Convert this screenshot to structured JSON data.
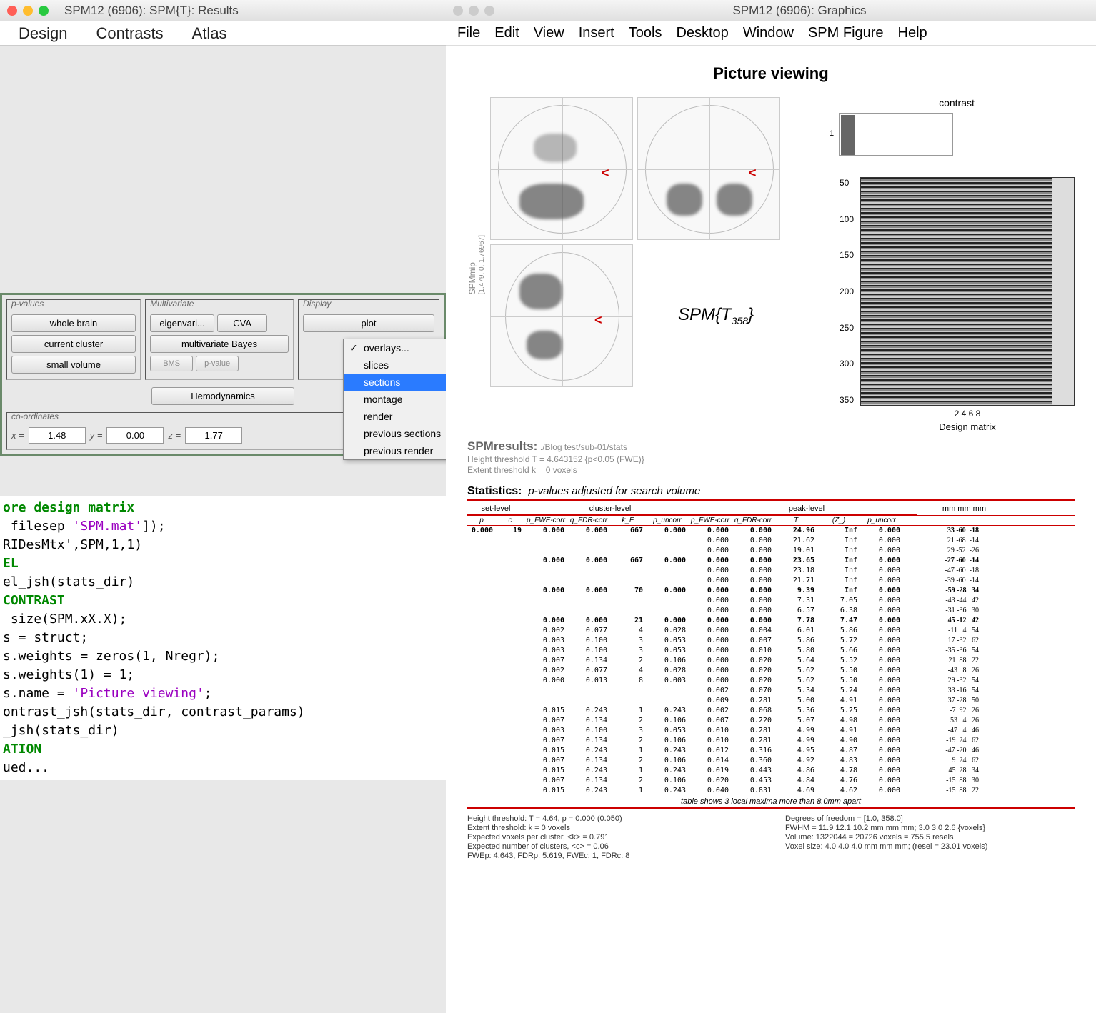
{
  "results_window": {
    "title": "SPM12 (6906): SPM{T}: Results",
    "menu": [
      "Design",
      "Contrasts",
      "Atlas"
    ],
    "groups": {
      "pvalues": {
        "label": "p-values",
        "buttons": [
          "whole brain",
          "current cluster",
          "small volume"
        ]
      },
      "multivariate": {
        "label": "Multivariate",
        "buttons": [
          "eigenvari...",
          "CVA",
          "multivariate Bayes",
          "BMS",
          "p-value"
        ]
      },
      "display": {
        "label": "Display",
        "buttons": [
          "plot"
        ]
      },
      "hemodynamics": "Hemodynamics",
      "coords": {
        "label": "co-ordinates",
        "x_label": "x =",
        "x": "1.48",
        "y_label": "y =",
        "y": "0.00",
        "z_label": "z =",
        "z": "1.77"
      }
    },
    "popup": [
      "overlays...",
      "slices",
      "sections",
      "montage",
      "render",
      "previous sections",
      "previous render"
    ]
  },
  "code_lines": [
    {
      "cls": "cmt",
      "t": "ore design matrix"
    },
    {
      "cls": "",
      "t": " filesep 'SPM.mat']);"
    },
    {
      "cls": "",
      "t": "RIDesMtx',SPM,1,1)"
    },
    {
      "cls": "",
      "t": ""
    },
    {
      "cls": "cmt",
      "t": "EL"
    },
    {
      "cls": "",
      "t": "el_jsh(stats_dir)"
    },
    {
      "cls": "",
      "t": ""
    },
    {
      "cls": "cmt",
      "t": "CONTRAST"
    },
    {
      "cls": "",
      "t": " size(SPM.xX.X);"
    },
    {
      "cls": "",
      "t": "s = struct;"
    },
    {
      "cls": "",
      "t": "s.weights = zeros(1, Nregr);"
    },
    {
      "cls": "",
      "t": "s.weights(1) = 1;"
    },
    {
      "cls": "",
      "t": "s.name = 'Picture viewing';"
    },
    {
      "cls": "",
      "t": "ontrast_jsh(stats_dir, contrast_params)"
    },
    {
      "cls": "",
      "t": ""
    },
    {
      "cls": "",
      "t": ""
    },
    {
      "cls": "",
      "t": "_jsh(stats_dir)"
    },
    {
      "cls": "",
      "t": ""
    },
    {
      "cls": "cmt",
      "t": "ATION"
    },
    {
      "cls": "",
      "t": "ued..."
    }
  ],
  "graphics_window": {
    "title": "SPM12 (6906): Graphics",
    "menu": [
      "File",
      "Edit",
      "View",
      "Insert",
      "Tools",
      "Desktop",
      "Window",
      "SPM Figure",
      "Help"
    ],
    "fig_title": "Picture viewing",
    "mip_label": "SPMmip",
    "mip_coords": "[1.479, 0, 1.76967]",
    "spmt": "SPM{T",
    "spmt_sub": "358",
    "spmt_end": "}",
    "contrast_label": "contrast",
    "design_matrix": {
      "yticks": [
        "50",
        "100",
        "150",
        "200",
        "250",
        "300",
        "350"
      ],
      "xticks": "2    4    6    8",
      "caption": "Design matrix"
    },
    "spmresults": {
      "title": "SPMresults:",
      "path": "./Blog test/sub-01/stats",
      "line1": "Height threshold T = 4.643152  {p<0.05 (FWE)}",
      "line2": "Extent threshold k = 0 voxels"
    },
    "stats_title": "Statistics:",
    "stats_sub": "p-values adjusted for search volume",
    "hdr_groups": {
      "set": "set-level",
      "cluster": "cluster-level",
      "peak": "peak-level",
      "mm": "mm mm mm"
    },
    "subhdr": [
      "p",
      "c",
      "p_FWE-corr",
      "q_FDR-corr",
      "k_E",
      "p_uncorr",
      "p_FWE-corr",
      "q_FDR-corr",
      "T",
      "(Z_)",
      "p_uncorr"
    ],
    "localmax": "table shows 3 local maxima more than 8.0mm apart",
    "footer_left": [
      "Height threshold: T = 4.64, p = 0.000 (0.050)",
      "Extent threshold: k = 0 voxels",
      "Expected voxels per cluster, <k> = 0.791",
      "Expected number of clusters, <c> = 0.06",
      "FWEp: 4.643, FDRp: 5.619, FWEc: 1, FDRc: 8"
    ],
    "footer_right": [
      "Degrees of freedom = [1.0, 358.0]",
      "FWHM = 11.9 12.1 10.2 mm mm mm; 3.0 3.0 2.6 {voxels}",
      "Volume: 1322044 = 20726 voxels = 755.5 resels",
      "Voxel size: 4.0 4.0 4.0 mm mm mm; (resel = 23.01 voxels)"
    ]
  },
  "chart_data": {
    "type": "table",
    "title": "Statistics: p-values adjusted for search volume",
    "columns": [
      "set_p",
      "set_c",
      "cl_pFWE",
      "cl_qFDR",
      "kE",
      "cl_puncorr",
      "pk_pFWE",
      "pk_qFDR",
      "T",
      "Z",
      "pk_puncorr",
      "mm_x",
      "mm_y",
      "mm_z"
    ],
    "rows": [
      [
        "0.000",
        "19",
        "0.000",
        "0.000",
        "667",
        "0.000",
        "0.000",
        "0.000",
        "24.96",
        "Inf",
        "0.000",
        "33",
        "-60",
        "-18"
      ],
      [
        "",
        "",
        "",
        "",
        "",
        "",
        "0.000",
        "0.000",
        "21.62",
        "Inf",
        "0.000",
        "21",
        "-68",
        "-14"
      ],
      [
        "",
        "",
        "",
        "",
        "",
        "",
        "0.000",
        "0.000",
        "19.01",
        "Inf",
        "0.000",
        "29",
        "-52",
        "-26"
      ],
      [
        "",
        "",
        "0.000",
        "0.000",
        "667",
        "0.000",
        "0.000",
        "0.000",
        "23.65",
        "Inf",
        "0.000",
        "-27",
        "-60",
        "-14"
      ],
      [
        "",
        "",
        "",
        "",
        "",
        "",
        "0.000",
        "0.000",
        "23.18",
        "Inf",
        "0.000",
        "-47",
        "-60",
        "-18"
      ],
      [
        "",
        "",
        "",
        "",
        "",
        "",
        "0.000",
        "0.000",
        "21.71",
        "Inf",
        "0.000",
        "-39",
        "-60",
        "-14"
      ],
      [
        "",
        "",
        "0.000",
        "0.000",
        "70",
        "0.000",
        "0.000",
        "0.000",
        "9.39",
        "Inf",
        "0.000",
        "-59",
        "-28",
        "34"
      ],
      [
        "",
        "",
        "",
        "",
        "",
        "",
        "0.000",
        "0.000",
        "7.31",
        "7.05",
        "0.000",
        "-43",
        "-44",
        "42"
      ],
      [
        "",
        "",
        "",
        "",
        "",
        "",
        "0.000",
        "0.000",
        "6.57",
        "6.38",
        "0.000",
        "-31",
        "-36",
        "30"
      ],
      [
        "",
        "",
        "0.000",
        "0.000",
        "21",
        "0.000",
        "0.000",
        "0.000",
        "7.78",
        "7.47",
        "0.000",
        "45",
        "-12",
        "42"
      ],
      [
        "",
        "",
        "0.002",
        "0.077",
        "4",
        "0.028",
        "0.000",
        "0.004",
        "6.01",
        "5.86",
        "0.000",
        "-11",
        "4",
        "54"
      ],
      [
        "",
        "",
        "0.003",
        "0.100",
        "3",
        "0.053",
        "0.000",
        "0.007",
        "5.86",
        "5.72",
        "0.000",
        "17",
        "-32",
        "62"
      ],
      [
        "",
        "",
        "0.003",
        "0.100",
        "3",
        "0.053",
        "0.000",
        "0.010",
        "5.80",
        "5.66",
        "0.000",
        "-35",
        "-36",
        "54"
      ],
      [
        "",
        "",
        "0.007",
        "0.134",
        "2",
        "0.106",
        "0.000",
        "0.020",
        "5.64",
        "5.52",
        "0.000",
        "21",
        "88",
        "22"
      ],
      [
        "",
        "",
        "0.002",
        "0.077",
        "4",
        "0.028",
        "0.000",
        "0.020",
        "5.62",
        "5.50",
        "0.000",
        "-43",
        "8",
        "26"
      ],
      [
        "",
        "",
        "0.000",
        "0.013",
        "8",
        "0.003",
        "0.000",
        "0.020",
        "5.62",
        "5.50",
        "0.000",
        "29",
        "-32",
        "54"
      ],
      [
        "",
        "",
        "",
        "",
        "",
        "",
        "0.002",
        "0.070",
        "5.34",
        "5.24",
        "0.000",
        "33",
        "-16",
        "54"
      ],
      [
        "",
        "",
        "",
        "",
        "",
        "",
        "0.009",
        "0.281",
        "5.00",
        "4.91",
        "0.000",
        "37",
        "-28",
        "50"
      ],
      [
        "",
        "",
        "0.015",
        "0.243",
        "1",
        "0.243",
        "0.002",
        "0.068",
        "5.36",
        "5.25",
        "0.000",
        "-7",
        "92",
        "26"
      ],
      [
        "",
        "",
        "0.007",
        "0.134",
        "2",
        "0.106",
        "0.007",
        "0.220",
        "5.07",
        "4.98",
        "0.000",
        "53",
        "4",
        "26"
      ],
      [
        "",
        "",
        "0.003",
        "0.100",
        "3",
        "0.053",
        "0.010",
        "0.281",
        "4.99",
        "4.91",
        "0.000",
        "-47",
        "4",
        "46"
      ],
      [
        "",
        "",
        "0.007",
        "0.134",
        "2",
        "0.106",
        "0.010",
        "0.281",
        "4.99",
        "4.90",
        "0.000",
        "-19",
        "24",
        "62"
      ],
      [
        "",
        "",
        "0.015",
        "0.243",
        "1",
        "0.243",
        "0.012",
        "0.316",
        "4.95",
        "4.87",
        "0.000",
        "-47",
        "-20",
        "46"
      ],
      [
        "",
        "",
        "0.007",
        "0.134",
        "2",
        "0.106",
        "0.014",
        "0.360",
        "4.92",
        "4.83",
        "0.000",
        "9",
        "24",
        "62"
      ],
      [
        "",
        "",
        "0.015",
        "0.243",
        "1",
        "0.243",
        "0.019",
        "0.443",
        "4.86",
        "4.78",
        "0.000",
        "45",
        "28",
        "34"
      ],
      [
        "",
        "",
        "0.007",
        "0.134",
        "2",
        "0.106",
        "0.020",
        "0.453",
        "4.84",
        "4.76",
        "0.000",
        "-15",
        "88",
        "30"
      ],
      [
        "",
        "",
        "0.015",
        "0.243",
        "1",
        "0.243",
        "0.040",
        "0.831",
        "4.69",
        "4.62",
        "0.000",
        "-15",
        "88",
        "22"
      ]
    ]
  }
}
